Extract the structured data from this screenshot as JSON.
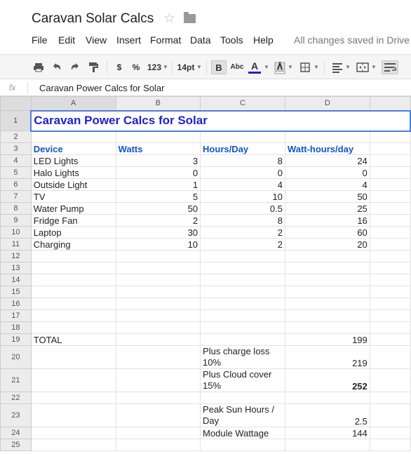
{
  "title": "Caravan Solar Calcs",
  "icons": {
    "star": "star-icon",
    "folder": "folder-icon"
  },
  "menus": [
    "File",
    "Edit",
    "View",
    "Insert",
    "Format",
    "Data",
    "Tools",
    "Help"
  ],
  "save_status": "All changes saved in Drive",
  "toolbar": {
    "currency": "$",
    "percent": "%",
    "number_format": "123",
    "font_size": "14pt",
    "bold": "B",
    "abc": "Abc",
    "text_color": "A",
    "text_color_value": "#1f1fcf"
  },
  "formula_bar": {
    "fx_label": "fx",
    "value": "Caravan Power Calcs for Solar"
  },
  "columns": [
    "A",
    "B",
    "C",
    "D"
  ],
  "rows": [
    {
      "n": "1",
      "a": "Caravan Power Calcs for Solar",
      "b": "",
      "c": "",
      "d": ""
    },
    {
      "n": "2",
      "a": "",
      "b": "",
      "c": "",
      "d": ""
    },
    {
      "n": "3",
      "a": "Device",
      "b": "Watts",
      "c": "Hours/Day",
      "d": "Watt-hours/day"
    },
    {
      "n": "4",
      "a": "LED Lights",
      "b": "3",
      "c": "8",
      "d": "24"
    },
    {
      "n": "5",
      "a": "Halo Lights",
      "b": "0",
      "c": "0",
      "d": "0"
    },
    {
      "n": "6",
      "a": "Outside Light",
      "b": "1",
      "c": "4",
      "d": "4"
    },
    {
      "n": "7",
      "a": "TV",
      "b": "5",
      "c": "10",
      "d": "50"
    },
    {
      "n": "8",
      "a": "Water Pump",
      "b": "50",
      "c": "0.5",
      "d": "25"
    },
    {
      "n": "9",
      "a": "Fridge Fan",
      "b": "2",
      "c": "8",
      "d": "16"
    },
    {
      "n": "10",
      "a": "Laptop",
      "b": "30",
      "c": "2",
      "d": "60"
    },
    {
      "n": "11",
      "a": "Charging",
      "b": "10",
      "c": "2",
      "d": "20"
    },
    {
      "n": "12",
      "a": "",
      "b": "",
      "c": "",
      "d": ""
    },
    {
      "n": "13",
      "a": "",
      "b": "",
      "c": "",
      "d": ""
    },
    {
      "n": "14",
      "a": "",
      "b": "",
      "c": "",
      "d": ""
    },
    {
      "n": "15",
      "a": "",
      "b": "",
      "c": "",
      "d": ""
    },
    {
      "n": "16",
      "a": "",
      "b": "",
      "c": "",
      "d": ""
    },
    {
      "n": "17",
      "a": "",
      "b": "",
      "c": "",
      "d": ""
    },
    {
      "n": "18",
      "a": "",
      "b": "",
      "c": "",
      "d": ""
    },
    {
      "n": "19",
      "a": "TOTAL",
      "b": "",
      "c": "",
      "d": "199"
    },
    {
      "n": "20",
      "a": "",
      "b": "",
      "c": "Plus charge loss 10%",
      "d": "219"
    },
    {
      "n": "21",
      "a": "",
      "b": "",
      "c": "Plus Cloud cover 15%",
      "d": "252"
    },
    {
      "n": "22",
      "a": "",
      "b": "",
      "c": "",
      "d": ""
    },
    {
      "n": "23",
      "a": "",
      "b": "",
      "c": "Peak Sun Hours / Day",
      "d": "2.5"
    },
    {
      "n": "24",
      "a": "",
      "b": "",
      "c": "Module Wattage",
      "d": "144"
    },
    {
      "n": "25",
      "a": "",
      "b": "",
      "c": "",
      "d": ""
    }
  ]
}
